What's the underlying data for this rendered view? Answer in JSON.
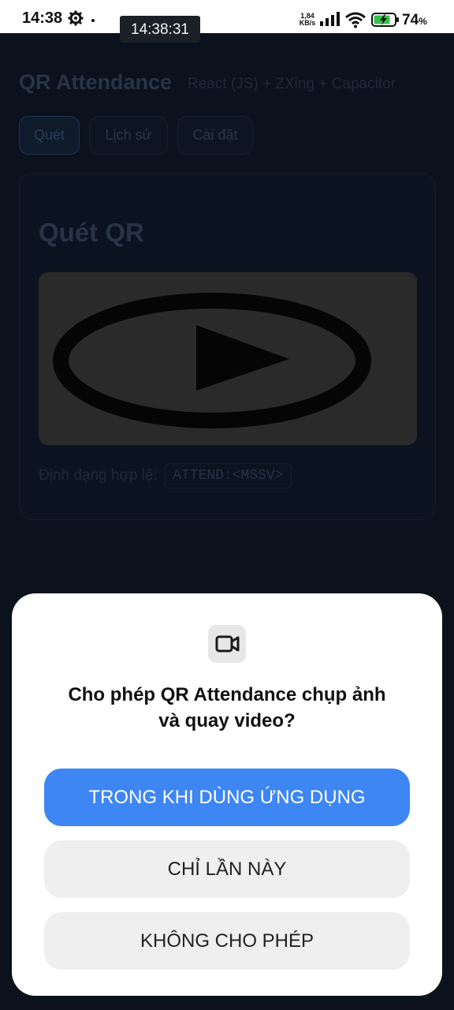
{
  "status_bar": {
    "time": "14:38",
    "clock_pill": "14:38:31",
    "net_speed_value": "1,84",
    "net_speed_unit": "KB/s",
    "battery_percent": "74",
    "battery_unit": "%"
  },
  "app": {
    "title": "QR Attendance",
    "subtitle": "React (JS) + ZXing + Capacitor",
    "tabs": [
      {
        "label": "Quét",
        "active": true
      },
      {
        "label": "Lịch sử",
        "active": false
      },
      {
        "label": "Cài đặt",
        "active": false
      }
    ],
    "scan_card": {
      "title": "Quét QR",
      "format_label": "Định dạng hợp lệ:",
      "format_code": "ATTEND:<MSSV>"
    }
  },
  "permission_dialog": {
    "icon": "video-camera-icon",
    "title_line1": "Cho phép QR Attendance chụp ảnh",
    "title_line2": "và quay video?",
    "buttons": {
      "while_using": "TRONG KHI DÙNG ỨNG DỤNG",
      "only_this_time": "CHỈ LẦN NÀY",
      "deny": "KHÔNG CHO PHÉP"
    }
  },
  "colors": {
    "primary_button": "#3d86f4",
    "dialog_background": "#ffffff",
    "scrim_background": "#0b111d"
  }
}
